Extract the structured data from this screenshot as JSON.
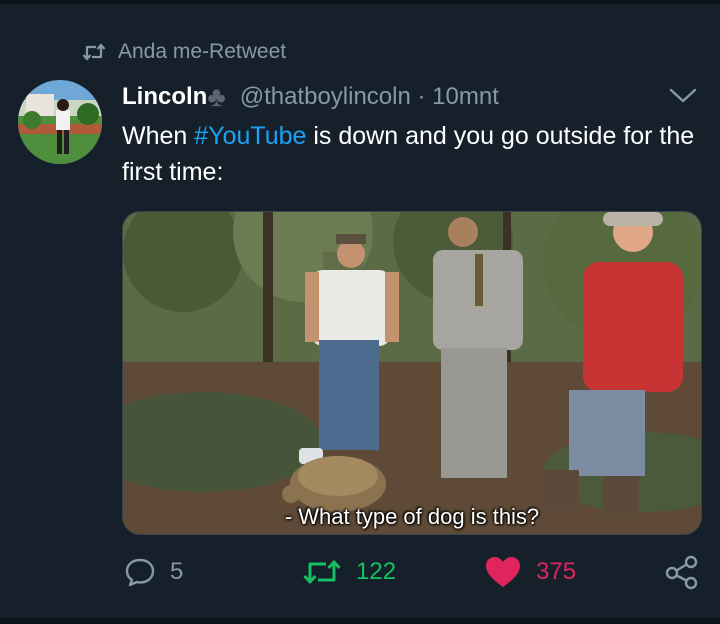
{
  "retweet_context": {
    "label": "Anda me-Retweet",
    "icon": "retweet-icon"
  },
  "tweet": {
    "author_name": "Lincoln",
    "name_emoji": "♣",
    "handle": "@thatboylincoln",
    "time": "10mnt",
    "text_before": "When ",
    "hashtag": "#YouTube",
    "text_after": " is down and you go outside for the first time:",
    "media_subtitle": "- What type of dog is this?"
  },
  "actions": {
    "reply_count": "5",
    "retweet_count": "122",
    "like_count": "375"
  },
  "colors": {
    "background": "#15202b",
    "hashtag": "#1da1f2",
    "retweet_green": "#17bf63",
    "like_red": "#e0245e",
    "muted": "#8899a6"
  }
}
